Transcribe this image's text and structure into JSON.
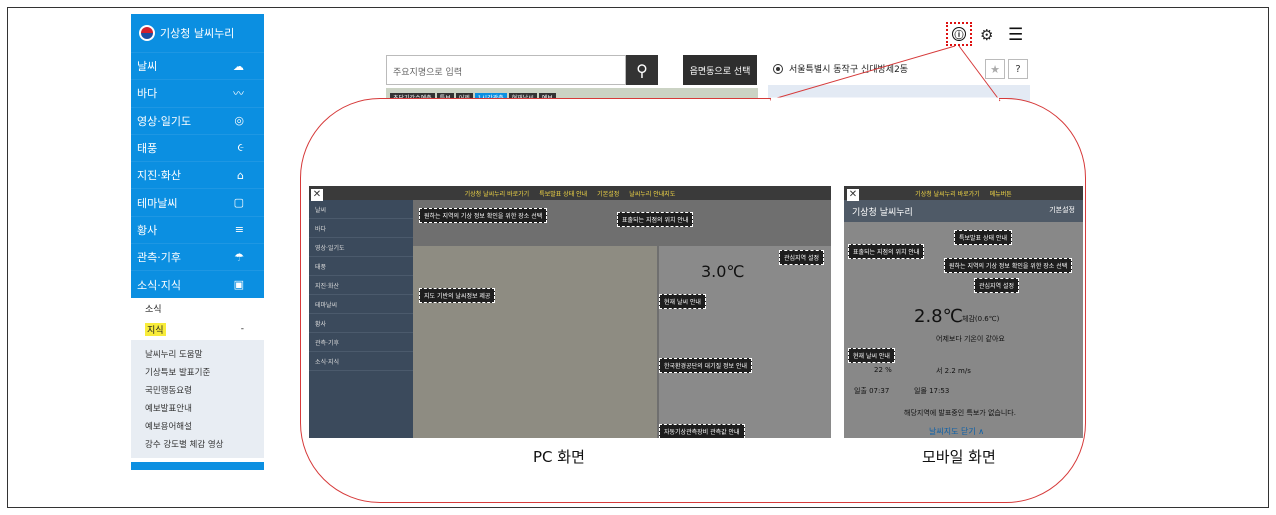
{
  "sidebar": {
    "title": "기상청 날씨누리",
    "items": [
      {
        "label": "날씨",
        "icon": "weather-icon"
      },
      {
        "label": "바다",
        "icon": "ocean-icon"
      },
      {
        "label": "영상·일기도",
        "icon": "radar-icon"
      },
      {
        "label": "태풍",
        "icon": "typhoon-icon"
      },
      {
        "label": "지진·화산",
        "icon": "earthquake-icon"
      },
      {
        "label": "테마날씨",
        "icon": "theme-icon"
      },
      {
        "label": "황사",
        "icon": "dust-icon"
      },
      {
        "label": "관측·기후",
        "icon": "observation-icon"
      },
      {
        "label": "소식·지식",
        "icon": "news-icon"
      }
    ],
    "sub": [
      {
        "label": "소식",
        "marker": ""
      },
      {
        "label": "지식",
        "marker": "-"
      }
    ],
    "links": [
      "날씨누리 도움말",
      "기상특보 발표기준",
      "국민행동요령",
      "예보발표안내",
      "예보용어해설",
      "강수 강도별 체감 영상"
    ]
  },
  "header": {
    "search_placeholder": "주요지명으로 입력",
    "region_button": "읍면동으로 선택",
    "location": "서울특별시 동작구 신대방제2동",
    "star": "★",
    "help": "?",
    "info_icon": "ⓘ"
  },
  "map_tabs": [
    "초단기강수예측",
    "특보",
    "어제",
    "1시간관측",
    "현재날씨",
    "예보"
  ],
  "callout": {
    "pc": {
      "caption": "PC 화면",
      "top_bar": [
        "기상청 날씨누리 바로가기",
        "특보발표 상태 안내",
        "기본설정",
        "날씨누리 안내지도"
      ],
      "labels": [
        "원하는 지역의 기상 정보 확인을 위한 장소 선택",
        "표출되는 지점의 위치 안내",
        "관심지역 설정",
        "지도 기반의 날씨정보 제공",
        "현재 날씨 안내",
        "한국환경공단의 대기질 정보 안내",
        "자동기상관측장비 관측값 안내"
      ],
      "temperature": "3.0℃",
      "sidebar": [
        "날씨",
        "바다",
        "영상·일기도",
        "태풍",
        "지진·화산",
        "테마날씨",
        "황사",
        "관측·기후",
        "소식·지식"
      ]
    },
    "mobile": {
      "caption": "모바일 화면",
      "top_bar": [
        "기상청 날씨누리 바로가기",
        "메뉴버튼"
      ],
      "head_title": "기상청 날씨누리",
      "head_right": "기본설정",
      "labels": [
        "특보발표 상태 안내",
        "표출되는 지점의 위치 안내",
        "원하는 지역의 기상 정보 확인을 위한 장소 선택",
        "관심지역 설정",
        "현재 날씨 안내"
      ],
      "temperature": "2.8℃",
      "feels": "체감(0.6℃)",
      "note": "어제보다 기온이 같아요",
      "humidity": "22 %",
      "wind": "서 2.2 m/s",
      "sunrise": "일출 07:37",
      "sunset": "일몰 17:53",
      "footer": "날씨지도 닫기 ∧",
      "no_warning": "해당지역에 발표중인 특보가 없습니다."
    }
  }
}
